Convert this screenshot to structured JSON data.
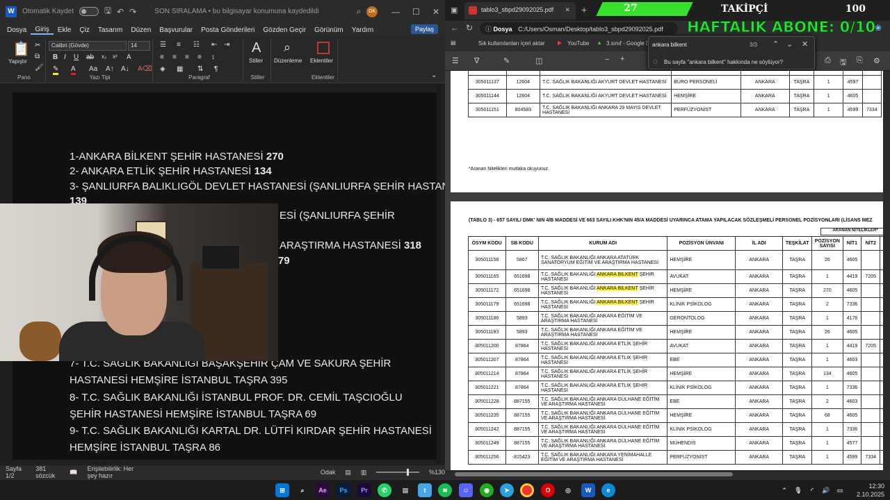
{
  "word": {
    "autosave": "Otomatik Kaydet",
    "doc_title": "SON SIRALAMA • bu bilgisayar konumuna kaydedildi",
    "user_initials": "OK",
    "menu": [
      "Dosya",
      "Giriş",
      "Ekle",
      "Çiz",
      "Tasarım",
      "Düzen",
      "Başvurular",
      "Posta Gönderileri",
      "Gözden Geçir",
      "Görünüm",
      "Yardım"
    ],
    "share": "Paylaş",
    "font_name": "Calibri (Gövde)",
    "font_size": "14",
    "ribbon": {
      "paste": "Yapıştır",
      "pano": "Pano",
      "yazi_tipi": "Yazı Tipi",
      "paragraf": "Paragraf",
      "stiller_btn": "Stiller",
      "stiller": "Stiller",
      "duzenleme": "Düzenleme",
      "eklentiler_btn": "Eklentiler",
      "eklentiler": "Eklentiler"
    },
    "lines": [
      {
        "t": "1-ANKARA BİLKENT ŞEHİR HASTANESİ ",
        "b": "270"
      },
      {
        "t": "2- ANKARA ETLİK ŞEHİR HASTANESİ ",
        "b": "134"
      },
      {
        "t": "3- ŞANLIURFA BALIKLIGÖL DEVLET HASTANESİ (ŞANLIURFA ŞEHİR HASTANESİ)",
        "b": ""
      },
      {
        "t": "",
        "b": "139"
      },
      {
        "t": "ESİ (ŞANLIURFA ŞEHİR",
        "b": ""
      },
      {
        "t": "ARAŞTIRMA HASTANESİ ",
        "b": "318"
      },
      {
        "t": "",
        "b": "79"
      },
      {
        "t": "7- T.C. SAĞLIK BAKANLIĞI BAŞAKŞEHİR ÇAM VE SAKURA ŞEHİR",
        "b": ""
      },
      {
        "t": "HASTANESİ HEMŞİRE İSTANBUL TAŞRA 395",
        "b": ""
      },
      {
        "t": "8- T.C. SAĞLIK BAKANLIĞI İSTANBUL PROF. DR. CEMİL TAŞCIOĞLU",
        "b": ""
      },
      {
        "t": "ŞEHİR HASTANESİ HEMŞİRE İSTANBUL TAŞRA 69",
        "b": ""
      },
      {
        "t": "9- T.C. SAĞLIK BAKANLIĞI KARTAL DR. LÜTFİ KIRDAR ŞEHİR HASTANESİ",
        "b": ""
      },
      {
        "t": "HEMŞİRE İSTANBUL TAŞRA 86",
        "b": ""
      }
    ],
    "status": {
      "page": "Sayfa 1/2",
      "words": "381 sözcük",
      "access": "Erişilebilirlik: Her şey hazır",
      "focus": "Odak",
      "zoom": "%130"
    }
  },
  "edge": {
    "tab_title": "tablo3_sbpd29092025.pdf",
    "url_label": "Dosya",
    "url": "C:/Users/Osman/Desktop/tablo3_sbpd29092025.pdf",
    "bookmarks": [
      "Sık kullanılanları içeri aktar",
      "YouTube",
      "3.sınıf - Google D"
    ],
    "find_query": "ankara bilkent",
    "find_count": "3/3",
    "ask": "Bu sayfa \"ankara bilkent\" hakkında ne söylüyor?",
    "top_rows": [
      [
        "305011130",
        "732119",
        "ANKARA YENİMAHALLE İLÇE SAĞLIK MÜDÜRLÜĞÜ",
        "ÇOCUK GELİŞİMCİSİ",
        "ANKARA",
        "TAŞRA",
        "1",
        "4148",
        ""
      ],
      [
        "305011137",
        "12604",
        "T.C. SAĞLIK BAKANLIĞI AKYURT DEVLET HASTANESİ",
        "BÜRO PERSONELİ",
        "ANKARA",
        "TAŞRA",
        "1",
        "4597",
        ""
      ],
      [
        "305011144",
        "12604",
        "T.C. SAĞLIK BAKANLIĞI AKYURT DEVLET HASTANESİ",
        "HEMŞİRE",
        "ANKARA",
        "TAŞRA",
        "1",
        "4605",
        ""
      ],
      [
        "305011151",
        "804583",
        "T.C. SAĞLIK BAKANLIĞI ANKARA 29 MAYIS DEVLET HASTANESİ",
        "PERFÜZYONİST",
        "ANKARA",
        "TAŞRA",
        "1",
        "4599",
        "7334"
      ]
    ],
    "note": "*Aranan Nitelikleri mutlaka okuyunuz.",
    "table_title": "(TABLO 3) - 657 SAYILI DMK' NIN 4/B MADDESİ VE 663 SAYILI KHK'NIN 45/A MADDESİ UYARINCA ATAMA YAPILACAK SÖZLEŞMELİ PERSONEL POZİSYONLARI (LİSANS MEZ",
    "aranan": "ARANAN NİTELİKLER*",
    "headers": [
      "ÖSYM KODU",
      "SB KODU",
      "KURUM ADI",
      "POZİSYON ÜNVANI",
      "İL ADI",
      "TEŞKİLAT",
      "POZİSYON SAYISI",
      "NİT1",
      "NİT2",
      "NİT3"
    ],
    "rows": [
      {
        "c": [
          "305011158",
          "5867",
          "",
          "HEMŞİRE",
          "ANKARA",
          "TAŞRA",
          "26",
          "4605",
          "",
          ""
        ],
        "k": [
          "T.C. SAĞLIK BAKANLIĞI ANKARA ATATÜRK SANATORYUM EĞİTİM VE ARAŞTIRMA HASTANESİ",
          "",
          ""
        ]
      },
      {
        "c": [
          "305011165",
          "651698",
          "",
          "AVUKAT",
          "ANKARA",
          "TAŞRA",
          "1",
          "4419",
          "7205",
          "7207"
        ],
        "k": [
          "T.C. SAĞLIK BAKANLIĞI ",
          "ANKARA BİLKENT",
          " ŞEHİR HASTANESİ"
        ]
      },
      {
        "c": [
          "305011172",
          "651698",
          "",
          "HEMŞİRE",
          "ANKARA",
          "TAŞRA",
          "270",
          "4605",
          "",
          ""
        ],
        "k": [
          "T.C. SAĞLIK BAKANLIĞI ",
          "ANKARA BİLKENT",
          " ŞEHİR HASTANESİ"
        ]
      },
      {
        "c": [
          "305011179",
          "651698",
          "",
          "KLİNİK PSİKOLOG",
          "ANKARA",
          "TAŞRA",
          "2",
          "7336",
          "",
          ""
        ],
        "k": [
          "T.C. SAĞLIK BAKANLIĞI ",
          "ANKARA BİLKENT",
          " ŞEHİR HASTANESİ"
        ]
      },
      {
        "c": [
          "305011186",
          "5893",
          "",
          "GERONTOLOG",
          "ANKARA",
          "TAŞRA",
          "1",
          "4176",
          "",
          ""
        ],
        "k": [
          "T.C. SAĞLIK BAKANLIĞI ANKARA EĞİTİM VE ARAŞTIRMA HASTANESİ",
          "",
          ""
        ]
      },
      {
        "c": [
          "305011193",
          "5893",
          "",
          "HEMŞİRE",
          "ANKARA",
          "TAŞRA",
          "26",
          "4605",
          "",
          ""
        ],
        "k": [
          "T.C. SAĞLIK BAKANLIĞI ANKARA EĞİTİM VE ARAŞTIRMA HASTANESİ",
          "",
          ""
        ]
      },
      {
        "c": [
          "305011200",
          "87864",
          "",
          "AVUKAT",
          "ANKARA",
          "TAŞRA",
          "1",
          "4419",
          "7205",
          "7207"
        ],
        "k": [
          "T.C. SAĞLIK BAKANLIĞI ANKARA ETLİK ŞEHİR HASTANESİ",
          "",
          ""
        ]
      },
      {
        "c": [
          "305011207",
          "87864",
          "",
          "EBE",
          "ANKARA",
          "TAŞRA",
          "1",
          "4603",
          "",
          ""
        ],
        "k": [
          "T.C. SAĞLIK BAKANLIĞI ANKARA ETLİK ŞEHİR HASTANESİ",
          "",
          ""
        ]
      },
      {
        "c": [
          "305011214",
          "87864",
          "",
          "HEMŞİRE",
          "ANKARA",
          "TAŞRA",
          "134",
          "4605",
          "",
          ""
        ],
        "k": [
          "T.C. SAĞLIK BAKANLIĞI ANKARA ETLİK ŞEHİR HASTANESİ",
          "",
          ""
        ]
      },
      {
        "c": [
          "305011221",
          "87864",
          "",
          "KLİNİK PSİKOLOG",
          "ANKARA",
          "TAŞRA",
          "1",
          "7336",
          "",
          ""
        ],
        "k": [
          "T.C. SAĞLIK BAKANLIĞI ANKARA ETLİK ŞEHİR HASTANESİ",
          "",
          ""
        ]
      },
      {
        "c": [
          "305011228",
          "887155",
          "",
          "EBE",
          "ANKARA",
          "TAŞRA",
          "2",
          "4603",
          "",
          ""
        ],
        "k": [
          "T.C. SAĞLIK BAKANLIĞI ANKARA GÜLHANE EĞİTİM VE ARAŞTIRMA HASTANESİ",
          "",
          ""
        ]
      },
      {
        "c": [
          "305011235",
          "887155",
          "",
          "HEMŞİRE",
          "ANKARA",
          "TAŞRA",
          "68",
          "4605",
          "",
          ""
        ],
        "k": [
          "T.C. SAĞLIK BAKANLIĞI ANKARA GÜLHANE EĞİTİM VE ARAŞTIRMA HASTANESİ",
          "",
          ""
        ]
      },
      {
        "c": [
          "305011242",
          "887155",
          "",
          "KLİNİK PSİKOLOG",
          "ANKARA",
          "TAŞRA",
          "1",
          "7336",
          "",
          ""
        ],
        "k": [
          "T.C. SAĞLIK BAKANLIĞI ANKARA GÜLHANE EĞİTİM VE ARAŞTIRMA HASTANESİ",
          "",
          ""
        ]
      },
      {
        "c": [
          "305011249",
          "887155",
          "",
          "MÜHENDİS",
          "ANKARA",
          "TAŞRA",
          "1",
          "4577",
          "",
          ""
        ],
        "k": [
          "T.C. SAĞLIK BAKANLIĞI ANKARA GÜLHANE EĞİTİM VE ARAŞTIRMA HASTANESİ",
          "",
          ""
        ]
      },
      {
        "c": [
          "305011256",
          "815423",
          "",
          "PERFÜZYONİST",
          "ANKARA",
          "TAŞRA",
          "1",
          "4599",
          "7334",
          ""
        ],
        "k": [
          "T.C. SAĞLIK BAKANLIĞI ANKARA YENİMAHALLE EĞİTİM VE ARAŞTIRMA HASTANESİ",
          "",
          ""
        ]
      }
    ]
  },
  "overlay": {
    "count": "27",
    "label": "TAKİPÇİ",
    "goal": "100",
    "weekly": "HAFTALIK ABONE: 0/10"
  },
  "taskbar": {
    "time": "12:30",
    "date": "2.10.2025"
  }
}
